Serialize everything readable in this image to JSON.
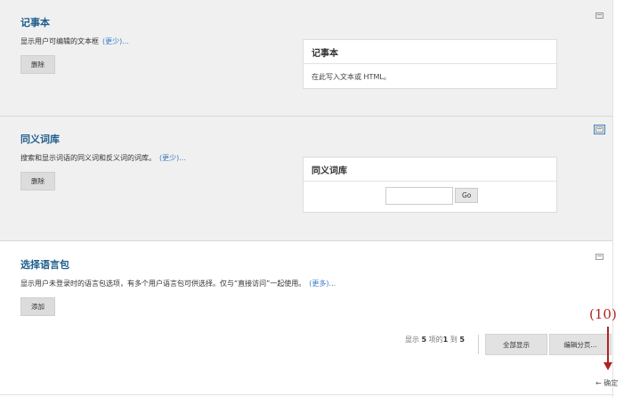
{
  "widgets": [
    {
      "title": "记事本",
      "description": "显示用户可编辑的文本框",
      "more": "(更少)...",
      "button": "删除",
      "preview_title": "记事本",
      "preview_body": "在此写入文本或 HTML。"
    },
    {
      "title": "同义词库",
      "description": "搜索和显示词语的同义词和反义词的词库。",
      "more": "(更少)...",
      "button": "删除",
      "preview_title": "同义词库",
      "go_label": "Go"
    },
    {
      "title": "选择语言包",
      "description": "显示用户未登录时的语言包选项，有多个用户语言包可供选择。仅与“直接访问”一起使用。",
      "more": "(更多)...",
      "button": "添加"
    }
  ],
  "pager": {
    "prefix": "显示",
    "total": "5",
    "middle": "项的",
    "from": "1",
    "to_word": "到",
    "to": "5"
  },
  "buttons": {
    "show_all": "全部显示",
    "edit_paging": "编辑分页..."
  },
  "annotation": {
    "number": "(10)",
    "label": "← 确定"
  },
  "colors": {
    "title": "#1f5e8c",
    "link": "#3a7bc8",
    "annotation": "#b22222"
  }
}
